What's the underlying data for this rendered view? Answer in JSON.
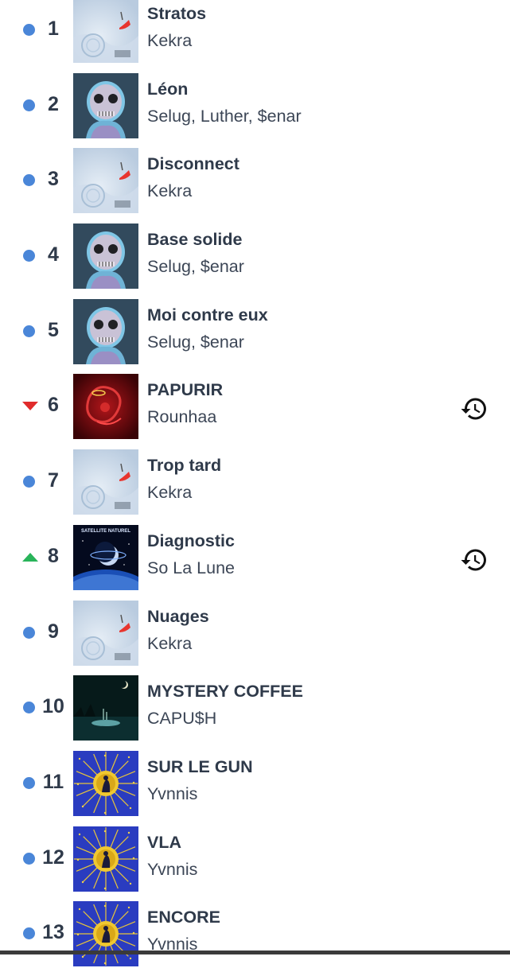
{
  "colors": {
    "same": "#4a86d8",
    "down": "#e02b2b",
    "up": "#29b45a",
    "text": "#2f3a4a"
  },
  "tracks": [
    {
      "rank": "1",
      "title": "Stratos",
      "artist": "Kekra",
      "trend": "same",
      "cover": "kekra",
      "history": false
    },
    {
      "rank": "2",
      "title": "Léon",
      "artist": "Selug, Luther, $enar",
      "trend": "same",
      "cover": "skull",
      "history": false
    },
    {
      "rank": "3",
      "title": "Disconnect",
      "artist": "Kekra",
      "trend": "same",
      "cover": "kekra",
      "history": false
    },
    {
      "rank": "4",
      "title": "Base solide",
      "artist": "Selug, $enar",
      "trend": "same",
      "cover": "skull",
      "history": false
    },
    {
      "rank": "5",
      "title": "Moi contre eux",
      "artist": "Selug, $enar",
      "trend": "same",
      "cover": "skull",
      "history": false
    },
    {
      "rank": "6",
      "title": "PAPURIR",
      "artist": "Rounhaa",
      "trend": "down",
      "cover": "red",
      "history": true
    },
    {
      "rank": "7",
      "title": "Trop tard",
      "artist": "Kekra",
      "trend": "same",
      "cover": "kekra",
      "history": false
    },
    {
      "rank": "8",
      "title": "Diagnostic",
      "artist": "So La Lune",
      "trend": "up",
      "cover": "planet",
      "history": true
    },
    {
      "rank": "9",
      "title": "Nuages",
      "artist": "Kekra",
      "trend": "same",
      "cover": "kekra",
      "history": false
    },
    {
      "rank": "10",
      "title": "MYSTERY COFFEE",
      "artist": "CAPU$H",
      "trend": "same",
      "cover": "night",
      "history": false
    },
    {
      "rank": "11",
      "title": "SUR LE GUN",
      "artist": "Yvnnis",
      "trend": "same",
      "cover": "sun",
      "history": false
    },
    {
      "rank": "12",
      "title": "VLA",
      "artist": "Yvnnis",
      "trend": "same",
      "cover": "sun",
      "history": false
    },
    {
      "rank": "13",
      "title": "ENCORE",
      "artist": "Yvnnis",
      "trend": "same",
      "cover": "sun",
      "history": false
    }
  ],
  "cover_text": {
    "planet_top": "SATELLITE NATUREL"
  },
  "icons": {
    "same": "dot-icon",
    "down": "arrow-down-icon",
    "up": "arrow-up-icon",
    "history": "history-icon"
  }
}
